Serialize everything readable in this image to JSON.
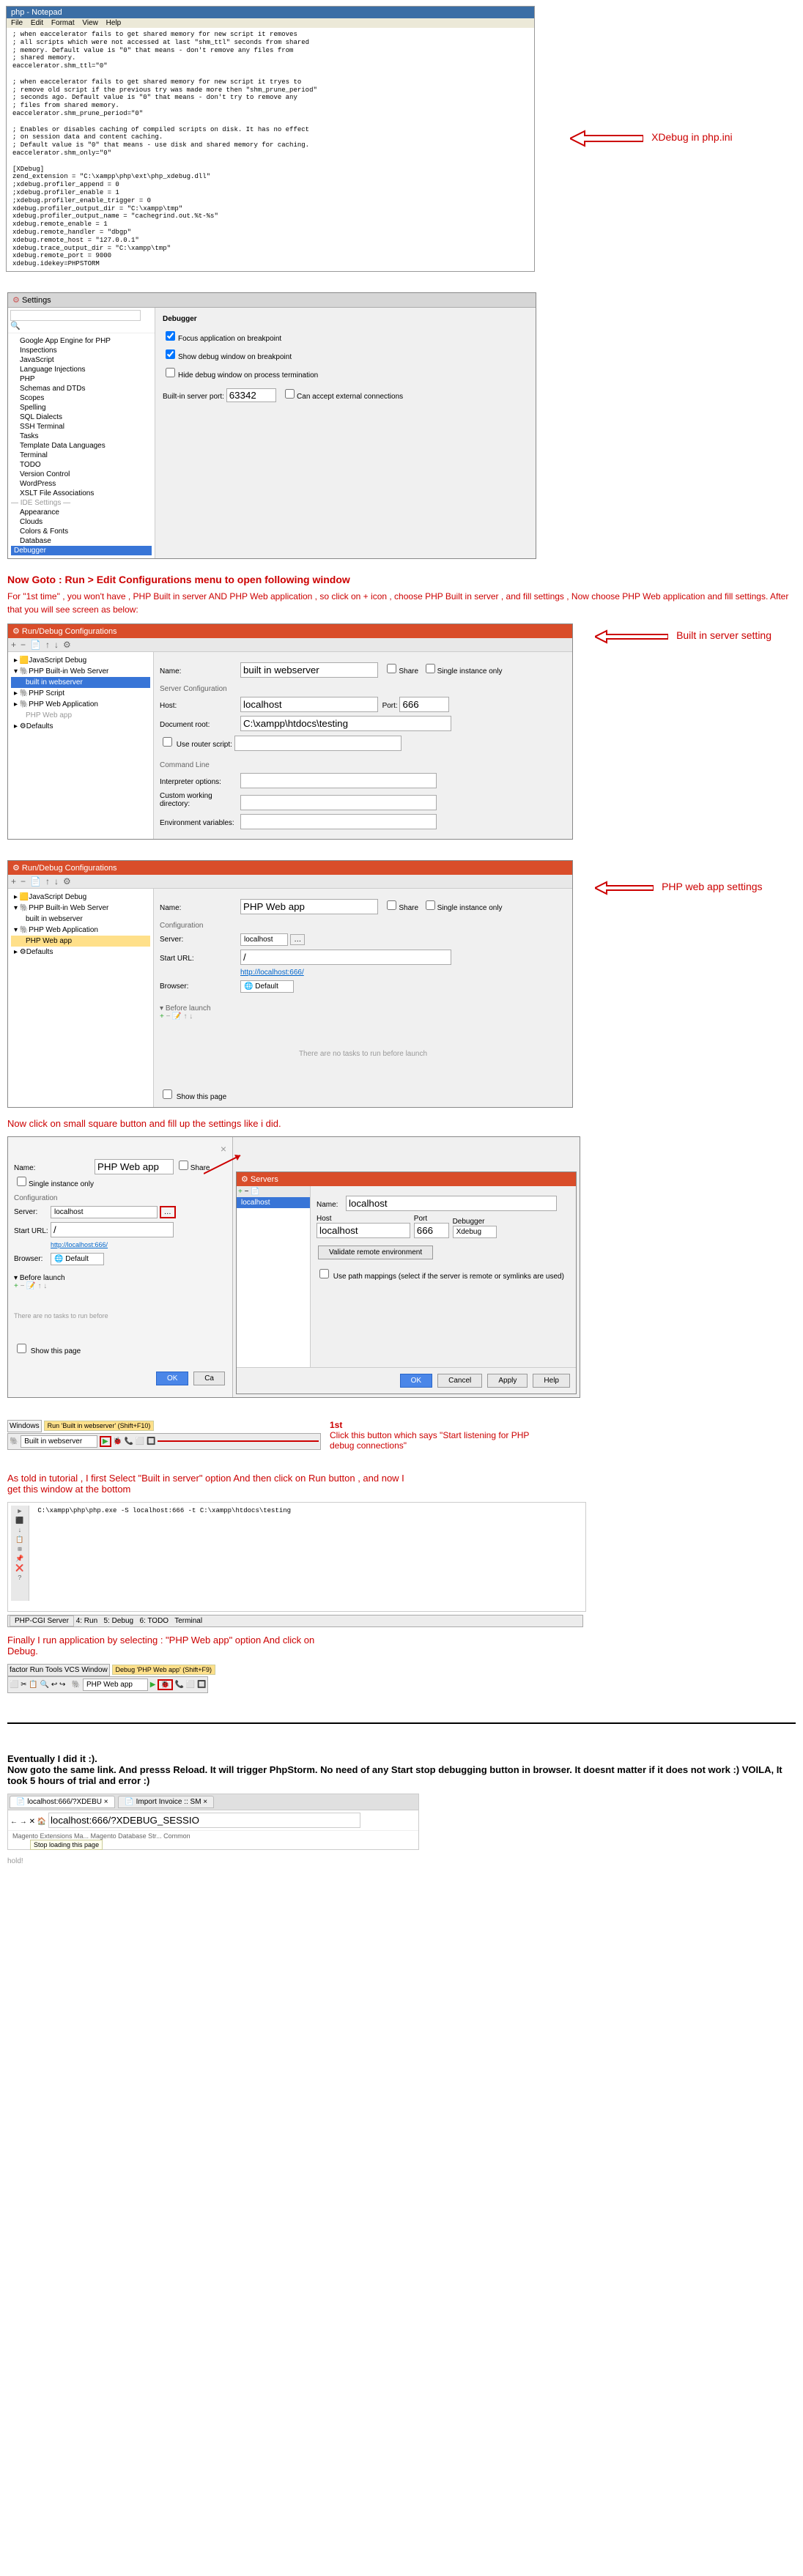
{
  "notepad": {
    "title": "php - Notepad",
    "menu": [
      "File",
      "Edit",
      "Format",
      "View",
      "Help"
    ],
    "body": "; when eaccelerator fails to get shared memory for new script it removes\n; all scripts which were not accessed at last \"shm_ttl\" seconds from shared\n; memory. Default value is \"0\" that means - don't remove any files from\n; shared memory.\neaccelerator.shm_ttl=\"0\"\n\n; when eaccelerator fails to get shared memory for new script it tryes to\n; remove old script if the previous try was made more then \"shm_prune_period\"\n; seconds ago. Default value is \"0\" that means - don't try to remove any\n; files from shared memory.\neaccelerator.shm_prune_period=\"0\"\n\n; Enables or disables caching of compiled scripts on disk. It has no effect\n; on session data and content caching.\n; Default value is \"0\" that means - use disk and shared memory for caching.\neaccelerator.shm_only=\"0\"\n\n[XDebug]\nzend_extension = \"C:\\xampp\\php\\ext\\php_xdebug.dll\"\n;xdebug.profiler_append = 0\n;xdebug.profiler_enable = 1\n;xdebug.profiler_enable_trigger = 0\nxdebug.profiler_output_dir = \"C:\\xampp\\tmp\"\nxdebug.profiler_output_name = \"cachegrind.out.%t-%s\"\nxdebug.remote_enable = 1\nxdebug.remote_handler = \"dbgp\"\nxdebug.remote_host = \"127.0.0.1\"\nxdebug.trace_output_dir = \"C:\\xampp\\tmp\"\nxdebug.remote_port = 9000\nxdebug.idekey=PHPSTORM"
  },
  "xdebug_label": "XDebug in php.ini",
  "settings": {
    "title": "Settings",
    "search_ph": "",
    "tree": [
      "Google App Engine for PHP",
      "Inspections",
      "JavaScript",
      "Language Injections",
      "PHP",
      "Schemas and DTDs",
      "Scopes",
      "Spelling",
      "SQL Dialects",
      "SSH Terminal",
      "Tasks",
      "Template Data Languages",
      "Terminal",
      "TODO",
      "Version Control",
      "WordPress",
      "XSLT File Associations",
      "— IDE Settings —",
      "Appearance",
      "Clouds",
      "Colors & Fonts",
      "Database"
    ],
    "tree_sel": "Debugger",
    "right_hdr": "Debugger",
    "cb1": "Focus application on breakpoint",
    "cb2": "Show debug window on breakpoint",
    "cb3": "Hide debug window on process termination",
    "port_lbl": "Built-in server port:",
    "port_val": "63342",
    "ext_cb": "Can accept external connections"
  },
  "goto_text": "Now Goto : Run > Edit Configurations menu to open following window",
  "firsttime_text": "For \"1st time\" , you won't have , PHP Built in server AND PHP Web application , so click on + icon , choose PHP Built in server , and fill settings , Now choose PHP Web application and fill settings. After that you will see  screen as below:",
  "runcfg1": {
    "title": "Run/Debug Configurations",
    "tree": [
      "JavaScript Debug",
      "PHP Built-in Web Server",
      "PHP Script",
      "PHP Web Application",
      "Defaults"
    ],
    "tree_sel": "built in webserver",
    "name_lbl": "Name:",
    "name_val": "built in webserver",
    "share": "Share",
    "single": "Single instance only",
    "hdr": "Server Configuration",
    "host_lbl": "Host:",
    "host_val": "localhost",
    "port_lbl": "Port:",
    "port_val": "666",
    "doc_lbl": "Document root:",
    "doc_val": "C:\\xampp\\htdocs\\testing",
    "router_lbl": "Use router script:",
    "cmd_hdr": "Command Line",
    "interp_lbl": "Interpreter options:",
    "cwd_lbl": "Custom working directory:",
    "env_lbl": "Environment variables:"
  },
  "builtin_label": "Built in server setting",
  "runcfg2": {
    "title": "Run/Debug Configurations",
    "tree": [
      "JavaScript Debug",
      "PHP Built-in Web Server",
      "PHP Web Application",
      "Defaults"
    ],
    "tree_sub1": "built in webserver",
    "tree_sel": "PHP Web app",
    "name_val": "PHP Web app",
    "cfg_hdr": "Configuration",
    "server_lbl": "Server:",
    "server_val": "localhost",
    "start_lbl": "Start URL:",
    "start_val": "/",
    "url": "http://localhost:666/",
    "browser_lbl": "Browser:",
    "browser_val": "Default",
    "before": "Before launch",
    "empty": "There are no tasks to run before launch",
    "show": "Show this page"
  },
  "phpweb_label": "PHP web app settings",
  "clicksquare": "Now click on small square button and fill up the settings like i did.",
  "servers": {
    "title": "Servers",
    "name_lbl": "Name:",
    "name_val": "localhost",
    "host_lbl": "Host",
    "host_val": "localhost",
    "port_lbl": "Port",
    "port_val": "666",
    "dbg_lbl": "Debugger",
    "dbg_val": "Xdebug",
    "valid_btn": "Validate remote environment",
    "path_cb": "Use path mappings (select if the server is remote or symlinks are used)",
    "ok": "OK",
    "cancel": "Cancel",
    "apply": "Apply",
    "help": "Help"
  },
  "listen": {
    "first": "1st",
    "text": "Click this button which says \"Start listening for PHP debug connections\""
  },
  "runbar1": {
    "windows": "Windows",
    "run": "Run 'Built in webserver' (Shift+F10)",
    "sel": "Built in webserver"
  },
  "astold": "As told in tutorial , I first Select \"Built in server\" option And then click on Run button , and now I get this window at the bottom",
  "terminal": {
    "cmd": "C:\\xampp\\php\\php.exe -S localhost:666 -t C:\\xampp\\htdocs\\testing",
    "tabs": [
      "PHP-CGI Server",
      "4: Run",
      "5: Debug",
      "6: TODO",
      "Terminal"
    ]
  },
  "finally": "Finally I run application by selecting : \"PHP Web app\" option And click on Debug.",
  "runbar2": {
    "menu": "factor  Run  Tools  VCS  Window",
    "btn": "Debug 'PHP Web app' (Shift+F9)",
    "sel": "PHP Web app"
  },
  "eventually": {
    "l1": "Eventually I did it :).",
    "l2": "Now goto the same link. And presss Reload. It will trigger PhpStorm. No need of any Start stop debugging button in browser. It doesnt matter if it does not work :) VOILA, It took 5 hours of trial and error :)"
  },
  "browser": {
    "tab1": "localhost:666/?XDEBU",
    "tab2": "Import Invoice :: SM",
    "url": "localhost:666/?XDEBUG_SESSIO",
    "status": "Magento Extensions Ma...  Magento Database Str...  Common",
    "loading": "Stop loading this page"
  },
  "hold": "hold!"
}
